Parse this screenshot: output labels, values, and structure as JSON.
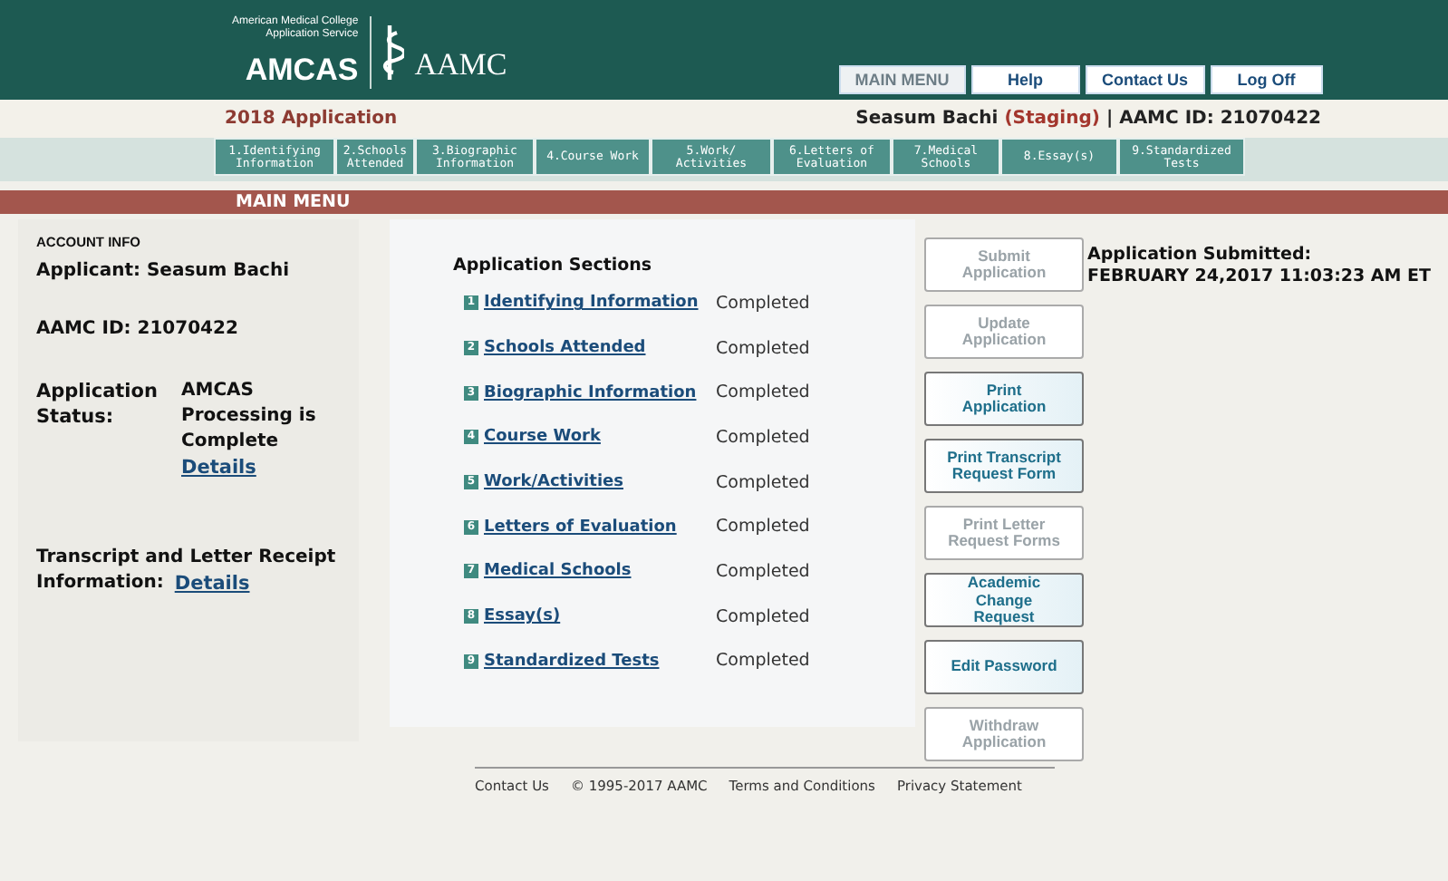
{
  "header": {
    "org_line1": "American Medical College",
    "org_line2": "Application Service",
    "brand": "AMCAS",
    "partner": "AAMC",
    "nav": [
      {
        "label": "MAIN MENU",
        "selected": true
      },
      {
        "label": "Help",
        "selected": false
      },
      {
        "label": "Contact Us",
        "selected": false
      },
      {
        "label": "Log Off",
        "selected": false
      }
    ]
  },
  "subheader": {
    "application": "2018 Application",
    "user": "Seasum Bachi",
    "env": "(Staging)",
    "separator": "|",
    "id": "AAMC ID: 21070422"
  },
  "steps": [
    {
      "label": "1.Identifying Information"
    },
    {
      "label": "2.Schools Attended"
    },
    {
      "label": "3.Biographic Information"
    },
    {
      "label": "4.Course Work"
    },
    {
      "label": "5.Work/ Activities"
    },
    {
      "label": "6.Letters of Evaluation"
    },
    {
      "label": "7.Medical Schools"
    },
    {
      "label": "8.Essay(s)"
    },
    {
      "label": "9.Standardized Tests"
    }
  ],
  "section_bar": "MAIN MENU",
  "account": {
    "heading": "ACCOUNT INFO",
    "applicant": "Applicant: Seasum Bachi",
    "aamc_id": "AAMC ID: 21070422",
    "status_label": "Application Status:",
    "status_value": "AMCAS Processing is Complete",
    "status_link": "Details",
    "receipt_label": "Transcript and Letter Receipt",
    "receipt_label2": "Information:",
    "receipt_link": "Details"
  },
  "sections": {
    "heading": "Application Sections",
    "items": [
      {
        "number": "1",
        "name": "Identifying Information",
        "status": "Completed"
      },
      {
        "number": "2",
        "name": "Schools Attended",
        "status": "Completed"
      },
      {
        "number": "3",
        "name": "Biographic Information",
        "status": "Completed"
      },
      {
        "number": "4",
        "name": "Course Work",
        "status": "Completed"
      },
      {
        "number": "5",
        "name": "Work/Activities",
        "status": "Completed"
      },
      {
        "number": "6",
        "name": "Letters of Evaluation",
        "status": "Completed"
      },
      {
        "number": "7",
        "name": "Medical Schools",
        "status": "Completed"
      },
      {
        "number": "8",
        "name": "Essay(s)",
        "status": "Completed"
      },
      {
        "number": "9",
        "name": "Standardized Tests",
        "status": "Completed"
      }
    ]
  },
  "actions": [
    {
      "label": "Submit Application",
      "disabled": true
    },
    {
      "label": "Update Application",
      "disabled": true
    },
    {
      "label": "Print Application",
      "disabled": false
    },
    {
      "label": "Print Transcript Request Form",
      "disabled": false
    },
    {
      "label": "Print Letter Request Forms",
      "disabled": true
    },
    {
      "label": "Academic Change Request",
      "disabled": false
    },
    {
      "label": "Edit Password",
      "disabled": false
    },
    {
      "label": "Withdraw Application",
      "disabled": true
    }
  ],
  "submitted": {
    "label": "Application Submitted:",
    "date": "FEBRUARY 24,2017 11:03:23 AM ET"
  },
  "footer": [
    "Contact Us",
    "© 1995-2017 AAMC",
    "Terms and Conditions",
    "Privacy Statement"
  ]
}
